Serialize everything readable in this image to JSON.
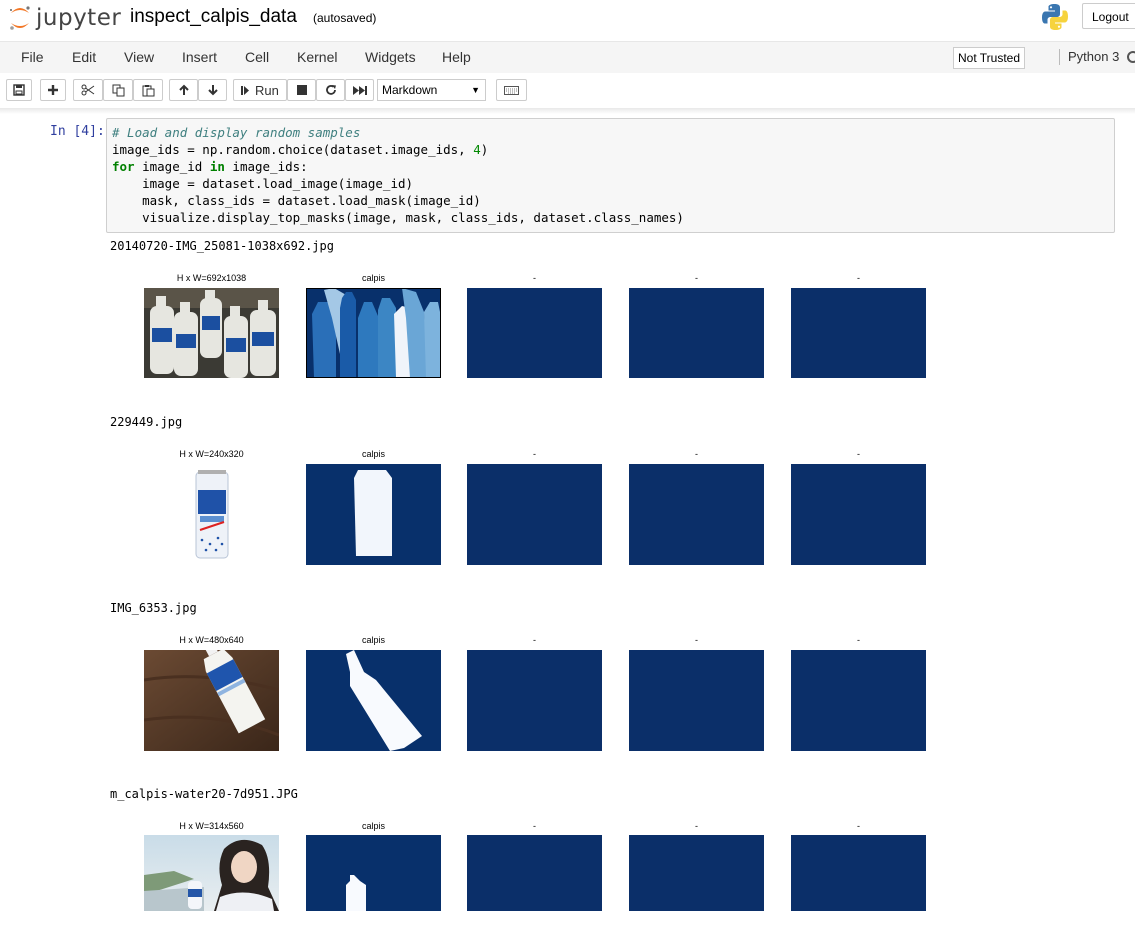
{
  "header": {
    "logo_text": "jupyter",
    "notebook_title": "inspect_calpis_data",
    "autosave_status": "(autosaved)",
    "logout_label": "Logout"
  },
  "menubar": {
    "items": [
      "File",
      "Edit",
      "View",
      "Insert",
      "Cell",
      "Kernel",
      "Widgets",
      "Help"
    ],
    "trust_status": "Not Trusted",
    "kernel_name": "Python 3"
  },
  "toolbar": {
    "run_label": "Run",
    "cell_type": "Markdown"
  },
  "cell": {
    "prompt": "In [4]:",
    "code": {
      "l1": "# Load and display random samples",
      "l2_a": "image_ids = np.random.choice(dataset.image_ids, ",
      "l2_n": "4",
      "l2_b": ")",
      "l3_kw": "for",
      "l3_a": " image_id ",
      "l3_kw2": "in",
      "l3_b": " image_ids:",
      "l4": "    image = dataset.load_image(image_id)",
      "l5": "    mask, class_ids = dataset.load_mask(image_id)",
      "l6": "    visualize.display_top_masks(image, mask, class_ids, dataset.class_names)"
    }
  },
  "outputs": [
    {
      "filename": "20140720-IMG_25081-1038x692.jpg",
      "titles": [
        "H x W=692x1038",
        "calpis",
        "-",
        "-",
        "-"
      ]
    },
    {
      "filename": "229449.jpg",
      "titles": [
        "H x W=240x320",
        "calpis",
        "-",
        "-",
        "-"
      ]
    },
    {
      "filename": "IMG_6353.jpg",
      "titles": [
        "H x W=480x640",
        "calpis",
        "-",
        "-",
        "-"
      ]
    },
    {
      "filename": "m_calpis-water20-7d951.JPG",
      "titles": [
        "H x W=314x560",
        "calpis",
        "-",
        "-",
        "-"
      ]
    }
  ],
  "colors": {
    "mask_background": "#0b2f69",
    "prompt": "#303f9f",
    "code_bg": "#f7f7f7"
  },
  "icons": [
    "jupyter-logo",
    "python-logo",
    "save-icon",
    "plus-icon",
    "cut-icon",
    "copy-icon",
    "paste-icon",
    "arrow-up-icon",
    "arrow-down-icon",
    "run-icon",
    "stop-icon",
    "restart-icon",
    "fast-forward-icon",
    "keyboard-icon"
  ]
}
